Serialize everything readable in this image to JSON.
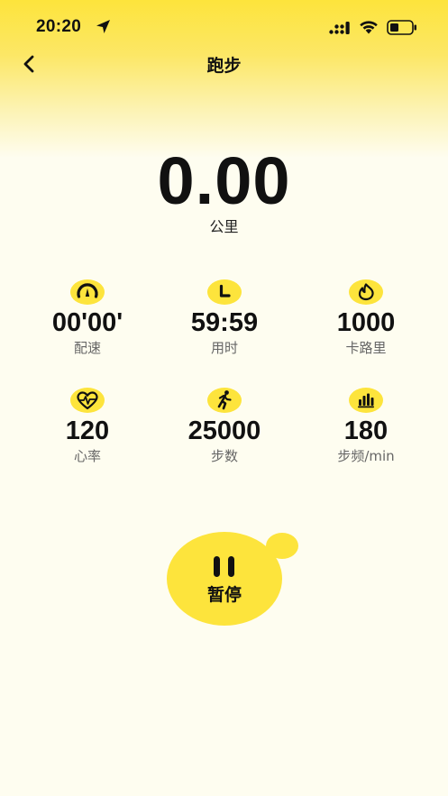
{
  "status_bar": {
    "time": "20:20",
    "icons": [
      "location-arrow-icon",
      "signal-icon",
      "wifi-icon",
      "battery-icon"
    ]
  },
  "nav": {
    "title": "跑步",
    "back_icon": "chevron-left-icon"
  },
  "distance": {
    "value": "0.00",
    "unit": "公里"
  },
  "stats": [
    {
      "icon": "speedometer-icon",
      "value": "00'00'",
      "label": "配速"
    },
    {
      "icon": "clock-icon",
      "value": "59:59",
      "label": "用时"
    },
    {
      "icon": "flame-icon",
      "value": "1000",
      "label": "卡路里"
    },
    {
      "icon": "heart-pulse-icon",
      "value": "120",
      "label": "心率"
    },
    {
      "icon": "runner-icon",
      "value": "25000",
      "label": "步数"
    },
    {
      "icon": "bar-chart-icon",
      "value": "180",
      "label": "步频/min"
    }
  ],
  "pause_button": {
    "label": "暂停",
    "icon": "pause-icon"
  },
  "colors": {
    "accent_yellow": "#FDE43C",
    "background": "#FEFDF0",
    "text_primary": "#111111",
    "text_secondary": "#666666"
  }
}
